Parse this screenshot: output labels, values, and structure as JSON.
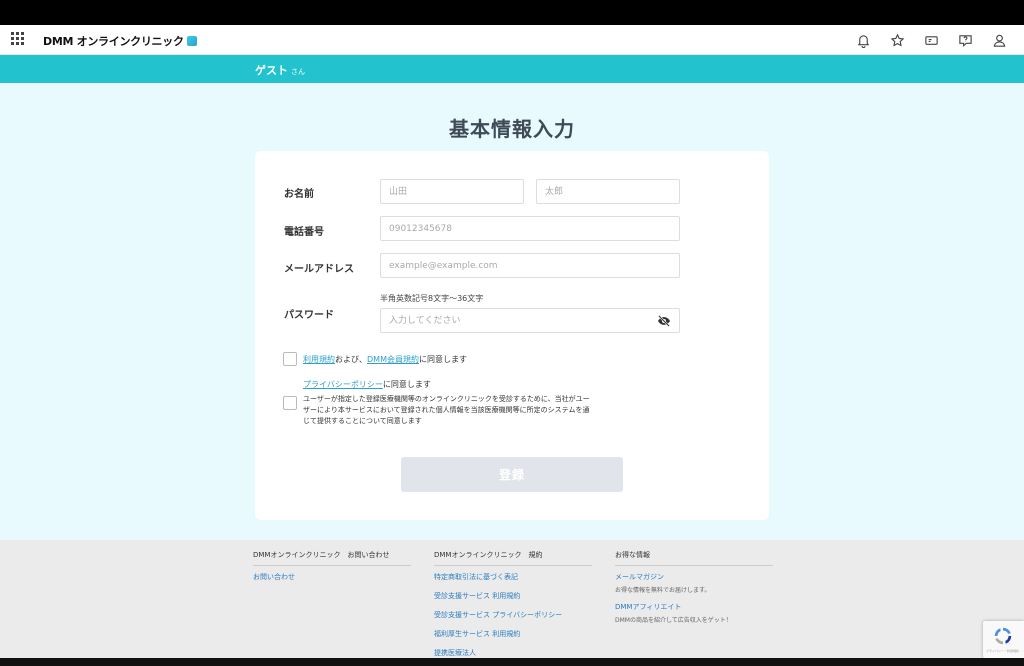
{
  "header": {
    "logo_text": "DMM オンラインクリニック",
    "icons": [
      "bell-icon",
      "star-icon",
      "ticket-icon",
      "help-icon",
      "user-icon"
    ]
  },
  "userbar": {
    "name": "ゲスト",
    "suffix": "さん"
  },
  "page": {
    "title": "基本情報入力"
  },
  "form": {
    "name_label": "お名前",
    "last_name_placeholder": "山田",
    "first_name_placeholder": "太郎",
    "phone_label": "電話番号",
    "phone_placeholder": "09012345678",
    "email_label": "メールアドレス",
    "email_placeholder": "example@example.com",
    "password_label": "パスワード",
    "password_hint": "半角英数記号8文字〜36文字",
    "password_placeholder": "入力してください",
    "terms": {
      "link1": "利用規約",
      "mid": "および、",
      "link2": "DMM会員規約",
      "end": "に同意します"
    },
    "privacy": {
      "link": "プライバシーポリシー",
      "end": "に同意します"
    },
    "consent_text": "ユーザーが指定した登録医療機関等のオンラインクリニックを受診するために、当社がユーザーにより本サービスにおいて登録された個人情報を当該医療機関等に所定のシステムを通じて提供することについて同意します",
    "submit_label": "登録"
  },
  "footer": {
    "col1": {
      "heading": "DMMオンラインクリニック　お問い合わせ",
      "links": [
        "お問い合わせ"
      ]
    },
    "col2": {
      "heading": "DMMオンラインクリニック　規約",
      "links": [
        "特定商取引法に基づく表記",
        "受診支援サービス 利用規約",
        "受診支援サービス プライバシーポリシー",
        "福利厚生サービス 利用規約",
        "提携医療法人"
      ]
    },
    "col3": {
      "heading": "お得な情報",
      "link1": "メールマガジン",
      "desc1": "お得な情報を無料でお届けします。",
      "link2": "DMMアフィリエイト",
      "desc2": "DMMの商品を紹介して広告収入をゲット！"
    }
  },
  "recaptcha": {
    "text": "プライバシー・利用規約"
  },
  "colors": {
    "accent": "#23c2cf",
    "background": "#e8fafd",
    "link": "#2ba0c8"
  }
}
